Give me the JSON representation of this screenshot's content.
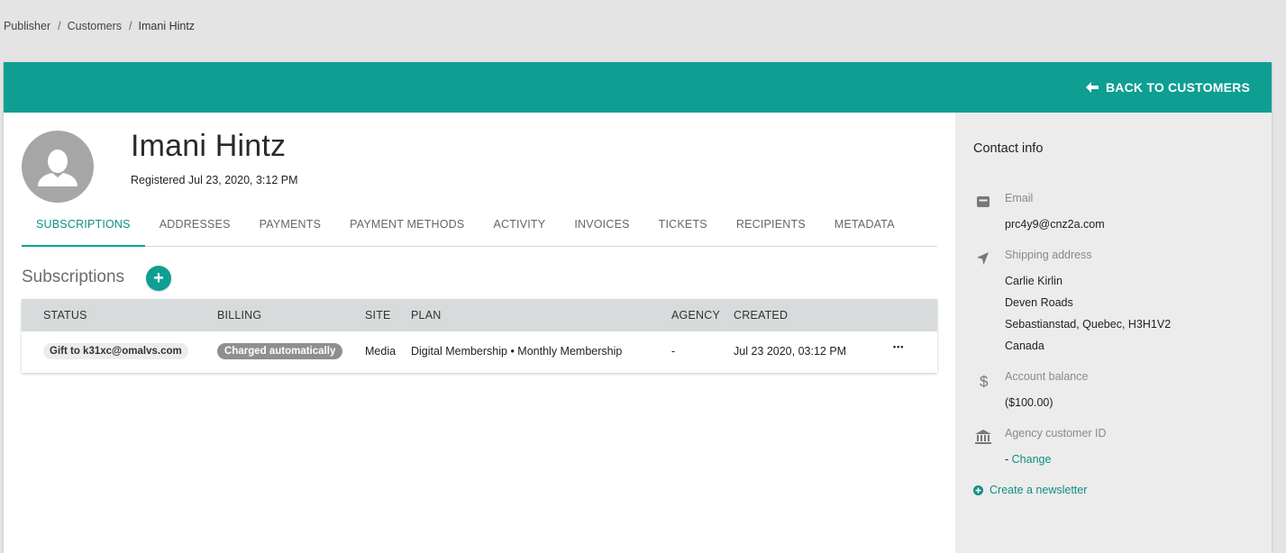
{
  "breadcrumb": {
    "items": [
      "Publisher",
      "Customers",
      "Imani Hintz"
    ],
    "separator": "/"
  },
  "header": {
    "back_label": "BACK TO CUSTOMERS",
    "accent_color": "#0e9e92"
  },
  "customer": {
    "name": "Imani Hintz",
    "registered": "Registered Jul 23, 2020, 3:12 PM"
  },
  "tabs": [
    {
      "label": "SUBSCRIPTIONS",
      "active": true
    },
    {
      "label": "ADDRESSES"
    },
    {
      "label": "PAYMENTS"
    },
    {
      "label": "PAYMENT METHODS"
    },
    {
      "label": "ACTIVITY"
    },
    {
      "label": "INVOICES"
    },
    {
      "label": "TICKETS"
    },
    {
      "label": "RECIPIENTS"
    },
    {
      "label": "METADATA"
    }
  ],
  "subscriptions": {
    "title": "Subscriptions",
    "add_label": "+",
    "columns": {
      "status": "STATUS",
      "billing": "BILLING",
      "site": "SITE",
      "plan": "PLAN",
      "agency": "AGENCY",
      "created": "CREATED"
    },
    "rows": [
      {
        "status": "Gift to k31xc@omalvs.com",
        "billing": "Charged automatically",
        "site": "Media",
        "plan": "Digital Membership • Monthly Membership",
        "agency": "-",
        "created": "Jul 23 2020, 03:12 PM",
        "more": "•••"
      }
    ]
  },
  "contact": {
    "title": "Contact info",
    "email": {
      "label": "Email",
      "value": "prc4y9@cnz2a.com",
      "icon": "email-icon"
    },
    "shipping": {
      "label": "Shipping address",
      "icon": "location-arrow-icon",
      "lines": [
        "Carlie Kirlin",
        "Deven Roads",
        "Sebastianstad, Quebec, H3H1V2",
        "Canada"
      ]
    },
    "balance": {
      "label": "Account balance",
      "value": "($100.00)",
      "icon": "dollar-icon"
    },
    "agency": {
      "label": "Agency customer ID",
      "prefix": "- ",
      "link": "Change",
      "icon": "bank-icon"
    },
    "newsletter": "Create a newsletter"
  }
}
